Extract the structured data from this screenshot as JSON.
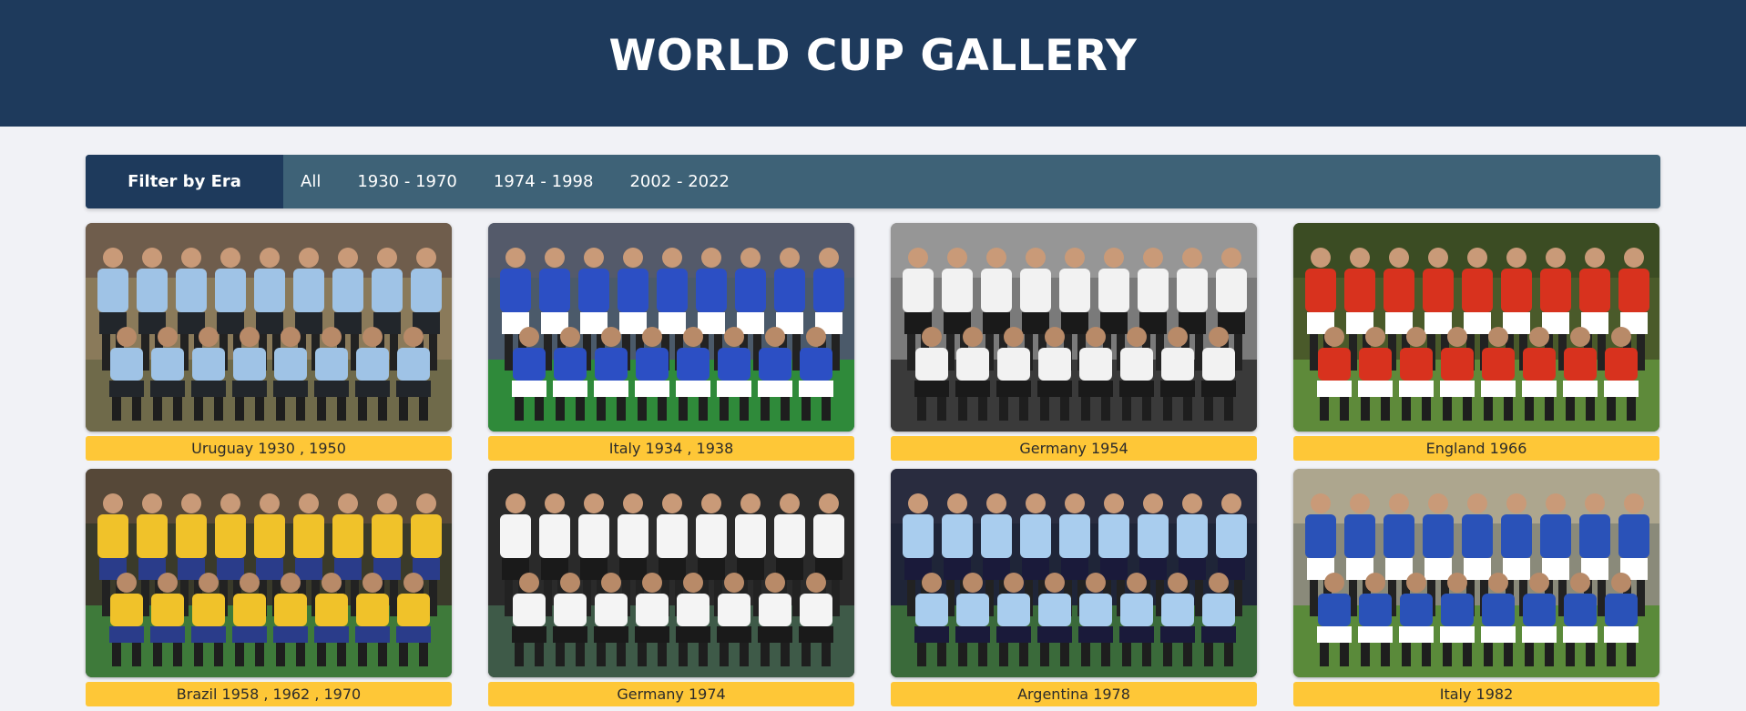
{
  "header": {
    "title": "WORLD CUP GALLERY"
  },
  "filter": {
    "label": "Filter by Era",
    "options": [
      "All",
      "1930 - 1970",
      "1974 - 1998",
      "2002 - 2022"
    ]
  },
  "gallery": [
    {
      "caption": "Uruguay 1930 , 1950",
      "bg": "#8a7a5a",
      "shirt": "#9fc3e6",
      "shorts": "#22262b",
      "grass": "#6f6a4a",
      "crowd": "#6b5a4a"
    },
    {
      "caption": "Italy 1934 , 1938",
      "bg": "#4b5a6a",
      "shirt": "#2c4fc4",
      "shorts": "#ffffff",
      "grass": "#2f8a3a",
      "crowd": "#555a6a"
    },
    {
      "caption": "Germany 1954",
      "bg": "#7a7a7a",
      "shirt": "#f2f2f2",
      "shorts": "#1a1a1a",
      "grass": "#3a3a3a",
      "crowd": "#999999"
    },
    {
      "caption": "England 1966",
      "bg": "#4a5a2a",
      "shirt": "#d8321e",
      "shorts": "#ffffff",
      "grass": "#5e8a3a",
      "crowd": "#3a4a22"
    },
    {
      "caption": "Brazil 1958 , 1962 , 1970",
      "bg": "#3a3a2a",
      "shirt": "#f0c22a",
      "shorts": "#2a3c8a",
      "grass": "#3e7a3a",
      "crowd": "#5a4a3a"
    },
    {
      "caption": "Germany 1974",
      "bg": "#2a2a2a",
      "shirt": "#f4f4f4",
      "shorts": "#1a1a1a",
      "grass": "#3e5a48",
      "crowd": "#2a2a2a"
    },
    {
      "caption": "Argentina 1978",
      "bg": "#1f2538",
      "shirt": "#a9cdee",
      "shorts": "#1a1a3a",
      "grass": "#3a6a3a",
      "crowd": "#2a2e40"
    },
    {
      "caption": "Italy 1982",
      "bg": "#8a8a7a",
      "shirt": "#2a52b8",
      "shorts": "#ffffff",
      "grass": "#5a8a3a",
      "crowd": "#b0a890"
    }
  ]
}
